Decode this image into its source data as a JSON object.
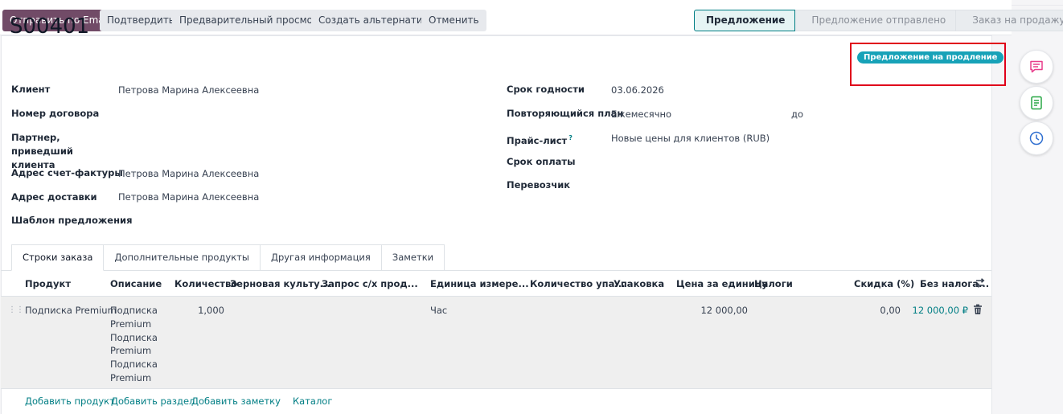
{
  "toolbar": {
    "send_email": "Отправить по Email",
    "confirm": "Подтвердить",
    "preview": "Предварительный просмотр",
    "create_alternative": "Создать альтернативу",
    "cancel": "Отменить"
  },
  "statusbar": {
    "stages": [
      "Предложение",
      "Предложение отправлено",
      "Заказ на продажу"
    ],
    "current": "Предложение"
  },
  "record": {
    "name": "S00401",
    "ribbon": "Предложение на продление"
  },
  "left_fields": [
    {
      "label": "Клиент",
      "value": "Петрова  Марина Алексеевна"
    },
    {
      "label": "Номер договора",
      "value": ""
    },
    {
      "label": "Партнер, приведший клиента",
      "value": ""
    },
    {
      "label": "Адрес счет-фактуры",
      "value": "Петрова  Марина Алексеевна"
    },
    {
      "label": "Адрес доставки",
      "value": "Петрова  Марина Алексеевна"
    },
    {
      "label": "Шаблон предложения",
      "value": ""
    }
  ],
  "right_fields": [
    {
      "label": "Срок годности",
      "value": "03.06.2026"
    },
    {
      "label": "Повторяющийся план",
      "value": "Ежемесячно",
      "extra": "до"
    },
    {
      "label": "Прайс-лист",
      "value": "Новые цены для клиентов (RUB)",
      "help": "?"
    },
    {
      "label": "Срок оплаты",
      "value": ""
    },
    {
      "label": "Перевозчик",
      "value": ""
    }
  ],
  "tabs": [
    "Строки заказа",
    "Дополнительные продукты",
    "Другая информация",
    "Заметки"
  ],
  "table": {
    "columns": [
      "Продукт",
      "Описание",
      "Количество",
      "Зерновая культу...",
      "Запрос с/х прод...",
      "Единица измере...",
      "Количество упа...",
      "Упаковка",
      "Цена за единицу",
      "Налоги",
      "Скидка (%)",
      "Без налога..."
    ],
    "row": {
      "product": "Подписка Premium",
      "description": [
        "Подписка",
        "Premium",
        "Подписка",
        "Premium",
        "Подписка",
        "Premium"
      ],
      "quantity": "1,000",
      "uom": "Час",
      "unit_price": "12 000,00",
      "discount": "0,00",
      "subtotal": "12 000,00 ₽"
    }
  },
  "footer_links": [
    "Добавить продукт",
    "Добавить раздел",
    "Добавить заметку",
    "Каталог"
  ],
  "colors": {
    "primary": "#714b67",
    "accent": "#017e84",
    "ribbon": "#17a2b8",
    "highlight": "#e0001a"
  },
  "side_icons": [
    "message-icon",
    "activity-icon",
    "clock-icon"
  ]
}
